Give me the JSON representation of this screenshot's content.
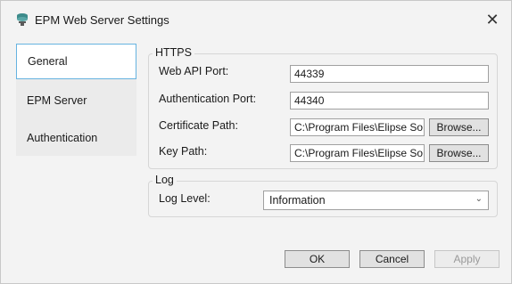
{
  "window": {
    "title": "EPM Web Server Settings",
    "app_icon": "server-stack-icon",
    "close_glyph": "✕"
  },
  "nav": {
    "items": [
      {
        "label": "General",
        "selected": true
      },
      {
        "label": "EPM Server",
        "selected": false
      },
      {
        "label": "Authentication",
        "selected": false
      }
    ]
  },
  "https": {
    "title": "HTTPS",
    "web_api_port_label": "Web API Port:",
    "web_api_port_value": "44339",
    "auth_port_label": "Authentication Port:",
    "auth_port_value": "44340",
    "cert_path_label": "Certificate Path:",
    "cert_path_value": "C:\\Program Files\\Elipse So",
    "key_path_label": "Key Path:",
    "key_path_value": "C:\\Program Files\\Elipse So",
    "browse_label": "Browse..."
  },
  "log": {
    "title": "Log",
    "level_label": "Log Level:",
    "level_value": "Information",
    "dropdown_glyph": "⌄"
  },
  "footer": {
    "ok_label": "OK",
    "cancel_label": "Cancel",
    "apply_label": "Apply"
  },
  "colors": {
    "window_bg": "#f3f3f3",
    "selection_border": "#66b3e0",
    "icon_teal": "#3d8b8b"
  }
}
